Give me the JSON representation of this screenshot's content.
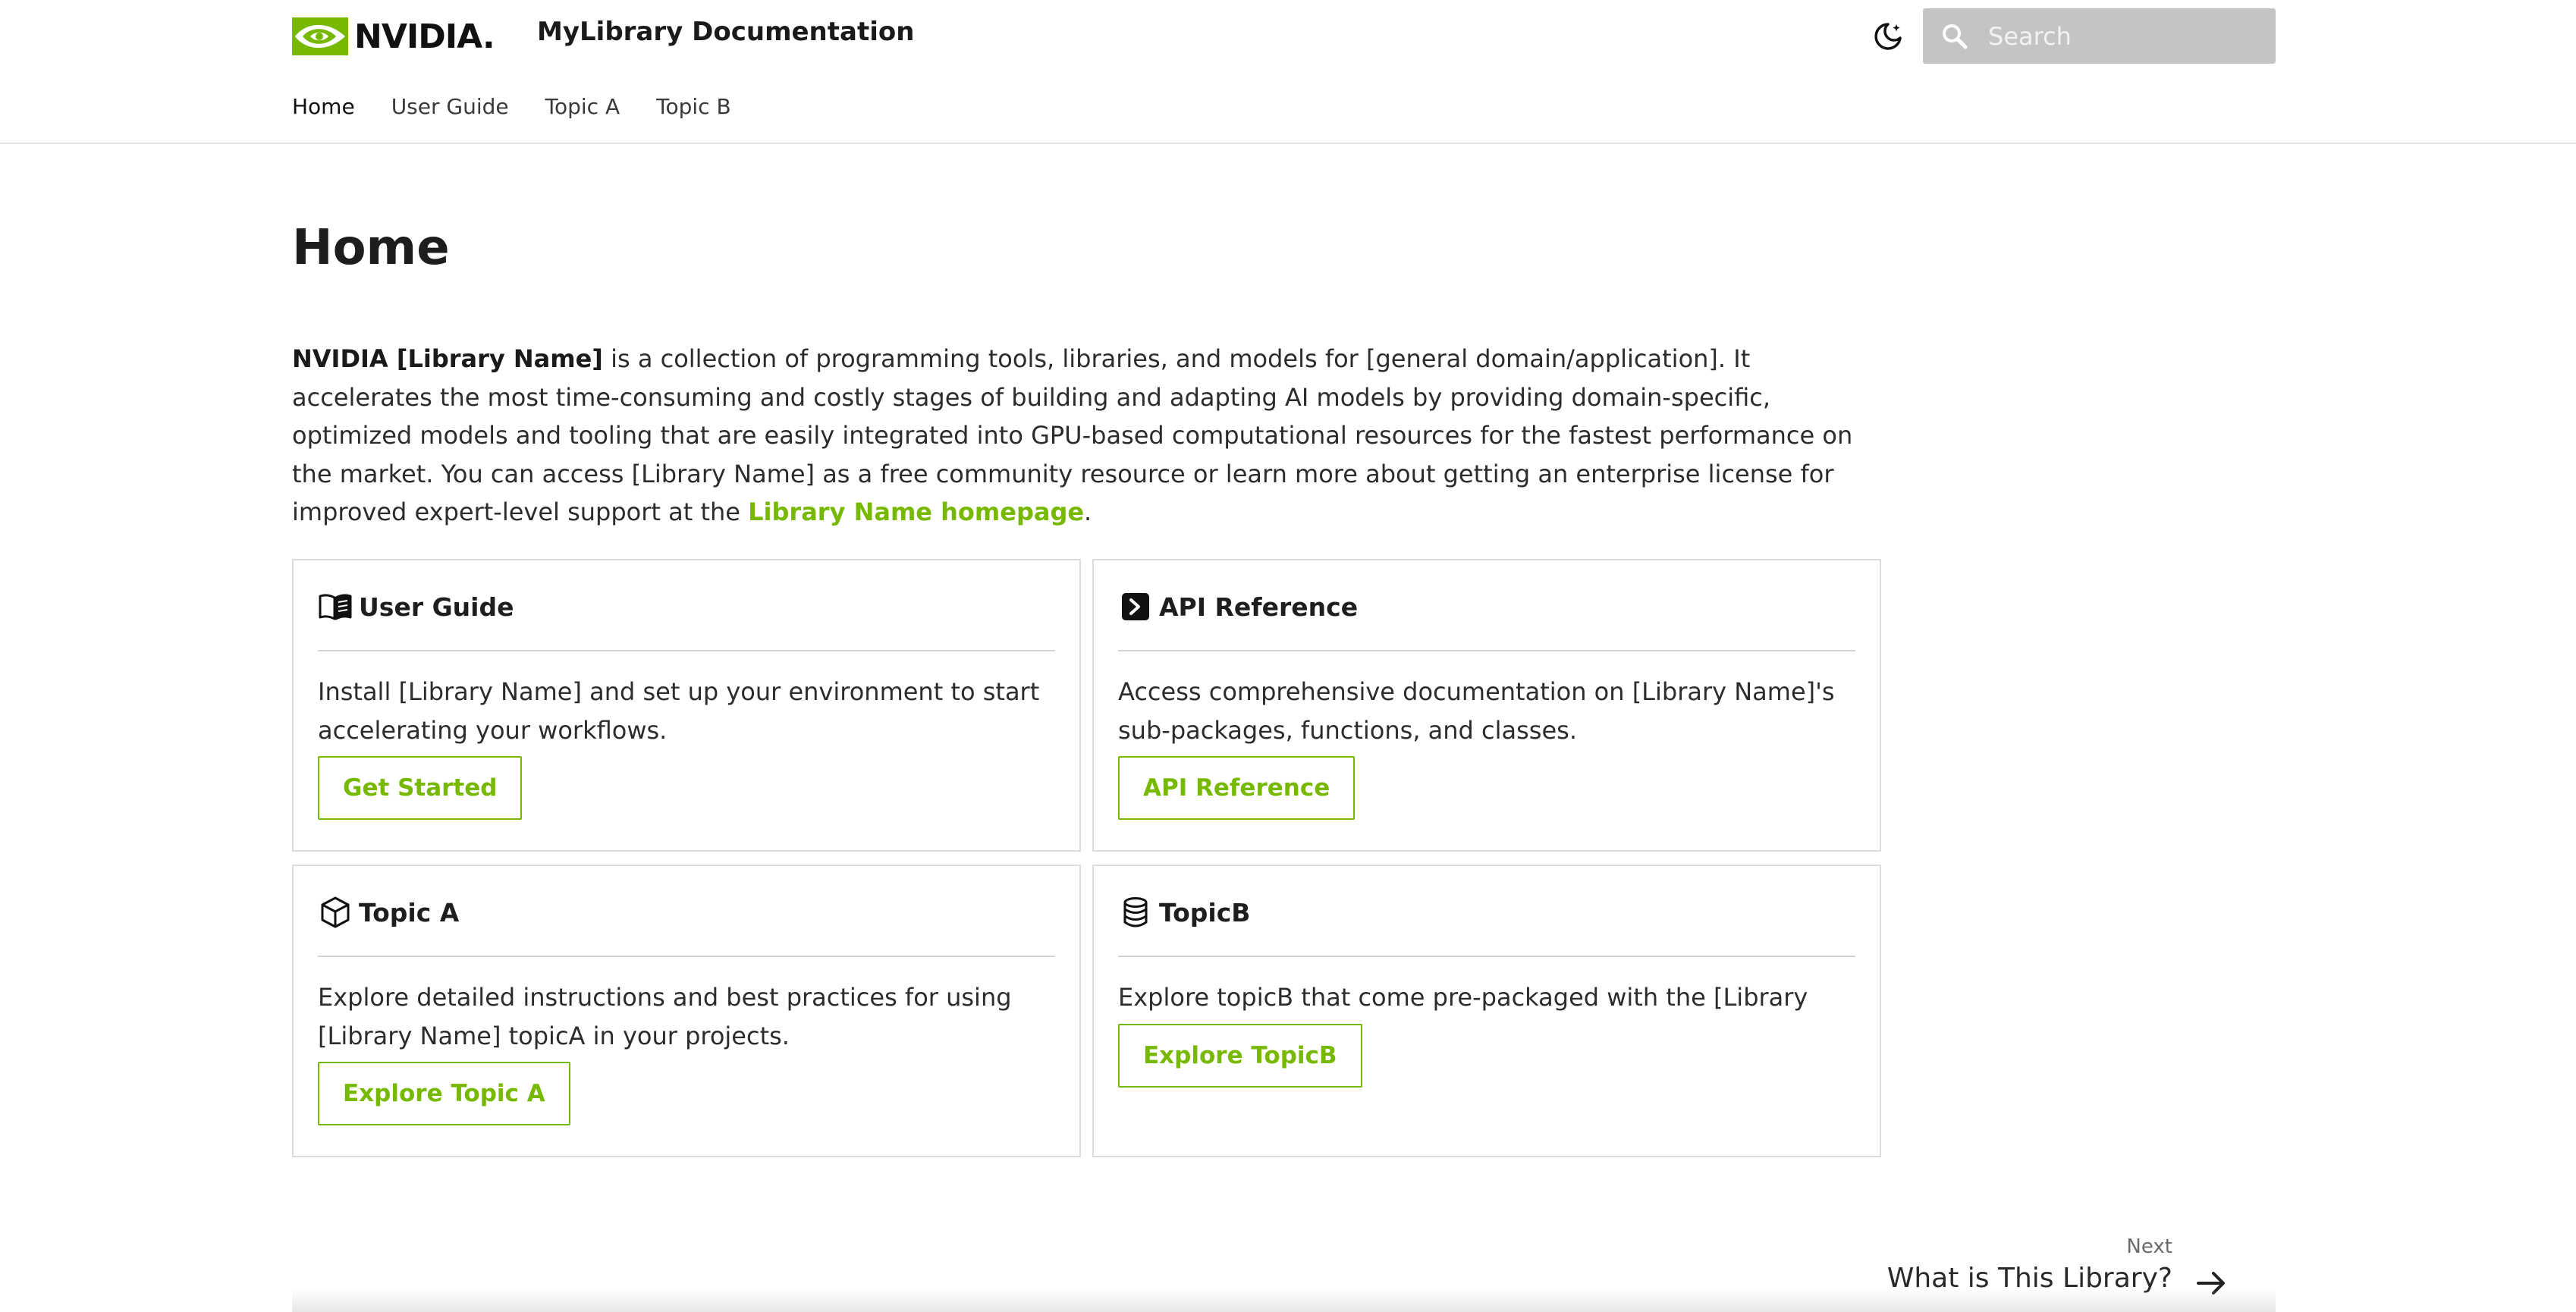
{
  "header": {
    "logo_text": "NVIDIA.",
    "site_title": "MyLibrary Documentation",
    "search_placeholder": "Search"
  },
  "nav": {
    "items": [
      {
        "label": "Home"
      },
      {
        "label": "User Guide"
      },
      {
        "label": "Topic A"
      },
      {
        "label": "Topic B"
      }
    ]
  },
  "page": {
    "title": "Home",
    "intro_bold": "NVIDIA [Library Name]",
    "intro_text": " is a collection of programming tools, libraries, and models for [general domain/application]. It accelerates the most time-consuming and costly stages of building and adapting AI models by providing domain-specific, optimized models and tooling that are easily integrated into GPU-based computational resources for the fastest performance on the market. You can access [Library Name] as a free community resource or learn more about getting an enterprise license for improved expert-level support at the ",
    "intro_link": "Library Name homepage",
    "intro_end": "."
  },
  "cards": [
    {
      "title": "User Guide",
      "icon": "book-icon",
      "description": "Install [Library Name] and set up your environment to start accelerating your workflows.",
      "button": "Get Started"
    },
    {
      "title": "API Reference",
      "icon": "terminal-icon",
      "description": "Access comprehensive documentation on [Library Name]'s sub-packages, functions, and classes.",
      "button": "API Reference"
    },
    {
      "title": "Topic A",
      "icon": "cube-icon",
      "description": "Explore detailed instructions and best practices for using [Library Name] topicA in your projects.",
      "button": "Explore Topic A"
    },
    {
      "title": "TopicB",
      "icon": "database-icon",
      "description": "Explore topicB that come pre-packaged with the [Library Name].",
      "button": "Explore TopicB"
    }
  ],
  "footer_nav": {
    "next_label": "Next",
    "next_title": "What is This Library?"
  },
  "colors": {
    "accent": "#76b900",
    "search_bg": "#c4c4c4"
  }
}
